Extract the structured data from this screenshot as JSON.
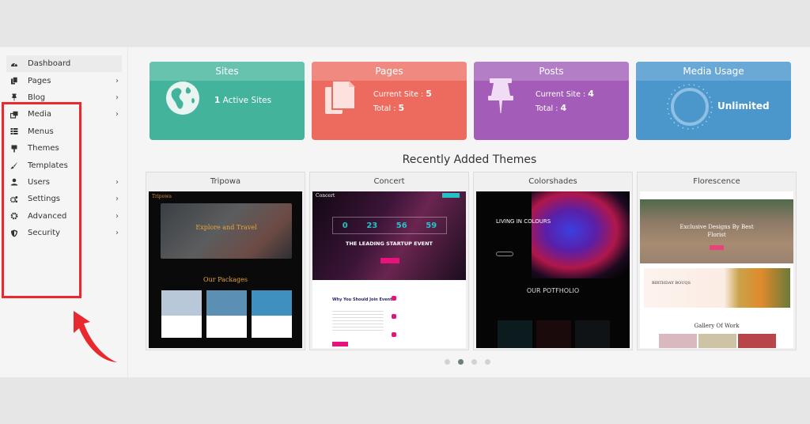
{
  "sidebar": {
    "items": [
      {
        "label": "Dashboard",
        "icon": "dashboard-icon",
        "has_submenu": false,
        "active": true
      },
      {
        "label": "Pages",
        "icon": "pages-icon",
        "has_submenu": true
      },
      {
        "label": "Blog",
        "icon": "pin-icon",
        "has_submenu": true
      },
      {
        "label": "Media",
        "icon": "media-icon",
        "has_submenu": true
      },
      {
        "label": "Menus",
        "icon": "list-icon",
        "has_submenu": false
      },
      {
        "label": "Themes",
        "icon": "paint-roller-icon",
        "has_submenu": false
      },
      {
        "label": "Templates",
        "icon": "brush-icon",
        "has_submenu": false
      },
      {
        "label": "Users",
        "icon": "user-icon",
        "has_submenu": true
      },
      {
        "label": "Settings",
        "icon": "cogs-icon",
        "has_submenu": true
      },
      {
        "label": "Advanced",
        "icon": "gear-icon",
        "has_submenu": true
      },
      {
        "label": "Security",
        "icon": "shield-icon",
        "has_submenu": true
      }
    ],
    "chevron": "›"
  },
  "stats": {
    "sites": {
      "title": "Sites",
      "value": "1",
      "text": "Active Sites",
      "color": "#43b39c"
    },
    "pages": {
      "title": "Pages",
      "current_label": "Current Site :",
      "current_value": "5",
      "total_label": "Total :",
      "total_value": "5",
      "color": "#ec6a5e"
    },
    "posts": {
      "title": "Posts",
      "current_label": "Current Site :",
      "current_value": "4",
      "total_label": "Total :",
      "total_value": "4",
      "color": "#a35db8"
    },
    "media": {
      "title": "Media Usage",
      "text": "Unlimited",
      "color": "#4b96cb"
    }
  },
  "themes": {
    "title": "Recently Added Themes",
    "items": [
      {
        "name": "Tripowa",
        "headline": "Explore and Travel",
        "sub": "Our Packages"
      },
      {
        "name": "Concert",
        "countdown": [
          "0",
          "23",
          "56",
          "59"
        ],
        "headline": "THE LEADING STARTUP EVENT",
        "sub": "Why You Should Join Event"
      },
      {
        "name": "Colorshades",
        "headline": "LIVING IN COLOURS",
        "sub": "OUR POTFHOLIO"
      },
      {
        "name": "Florescence",
        "headline": "Exclusive Designs By Best Florist",
        "sub": "Gallery Of Work",
        "banner": "BIRTHDAY BOUQS"
      }
    ],
    "pager": {
      "count": 4,
      "active": 1
    }
  }
}
